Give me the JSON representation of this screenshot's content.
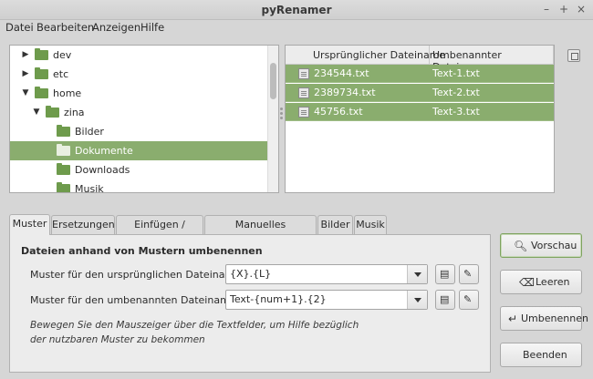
{
  "window": {
    "title": "pyRenamer"
  },
  "menu": [
    "Datei",
    "Bearbeiten",
    "Anzeigen",
    "Hilfe"
  ],
  "tree": [
    {
      "label": "dev",
      "depth": 0,
      "arrow": "collapsed"
    },
    {
      "label": "etc",
      "depth": 0,
      "arrow": "collapsed"
    },
    {
      "label": "home",
      "depth": 0,
      "arrow": "expanded"
    },
    {
      "label": "zina",
      "depth": 1,
      "arrow": "expanded"
    },
    {
      "label": "Bilder",
      "depth": 2,
      "arrow": "none"
    },
    {
      "label": "Dokumente",
      "depth": 2,
      "arrow": "none",
      "selected": true
    },
    {
      "label": "Downloads",
      "depth": 2,
      "arrow": "none"
    },
    {
      "label": "Musik",
      "depth": 2,
      "arrow": "none"
    }
  ],
  "files": {
    "columns": [
      "Ursprünglicher Dateiname",
      "Umbenannter Dateiname"
    ],
    "rows": [
      [
        "234544.txt",
        "Text-1.txt"
      ],
      [
        "2389734.txt",
        "Text-2.txt"
      ],
      [
        "45756.txt",
        "Text-3.txt"
      ]
    ]
  },
  "tabs": [
    "Muster",
    "Ersetzungen",
    "Einfügen / Löschen",
    "Manuelles Umbenennen",
    "Bilder",
    "Musik"
  ],
  "pattern": {
    "section_title": "Dateien anhand von Mustern umbenennen",
    "original_label": "Muster für den ursprünglichen Dateinamen",
    "original_value": "{X}.{L}",
    "renamed_label": "Muster für den umbenannten Dateinamen",
    "renamed_value": "Text-{num+1}.{2}",
    "hint": "Bewegen Sie den Mauszeiger über die Textfelder, um Hilfe bezüglich der nutzbaren Muster zu bekommen"
  },
  "buttons": {
    "preview": "Vorschau",
    "clear": "Leeren",
    "rename": "Umbenennen",
    "quit": "Beenden"
  },
  "colors": {
    "selection": "#8aad6e",
    "accent": "#6e9b4c"
  }
}
